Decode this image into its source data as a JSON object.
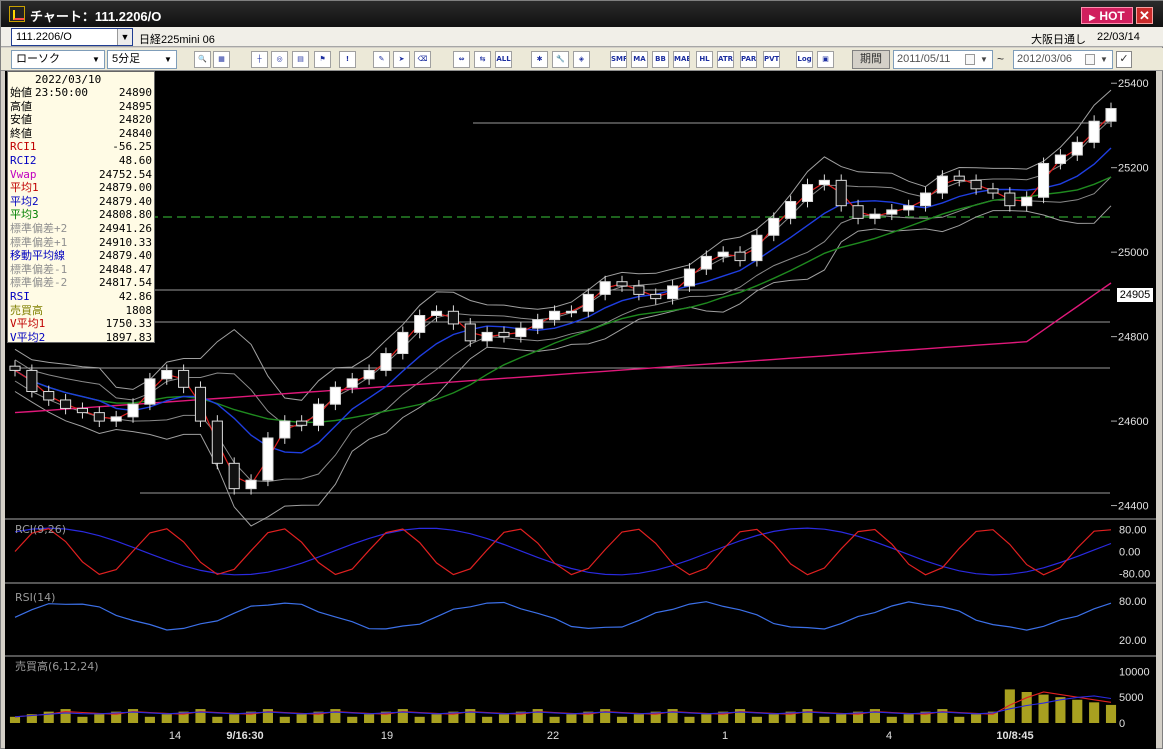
{
  "window": {
    "title": "チャート：111.2206/O",
    "hot_label": "HOT",
    "close_label": "✕"
  },
  "header": {
    "symbol": "111.2206/O",
    "instrument": "日経225mini 06",
    "market": "大阪日通し",
    "date": "22/03/14"
  },
  "toolbar": {
    "chart_type": "ローソク",
    "interval": "5分足",
    "period_label": "期間",
    "date_from": "2011/05/11",
    "date_to": "2012/03/06",
    "tilde": "~",
    "tools": [
      {
        "name": "zoom-icon",
        "text": "🔍"
      },
      {
        "name": "layout-icon",
        "text": "▦"
      },
      {
        "name": "candle-icon",
        "text": "┼"
      },
      {
        "name": "magnify-icon",
        "text": "◎"
      },
      {
        "name": "table-icon",
        "text": "▤"
      },
      {
        "name": "flag-icon",
        "text": "⚑"
      },
      {
        "name": "alert-icon",
        "text": "!"
      },
      {
        "name": "pen-icon",
        "text": "✎"
      },
      {
        "name": "pointer-icon",
        "text": "➤"
      },
      {
        "name": "eraser-icon",
        "text": "⌫"
      },
      {
        "name": "compare-icon",
        "text": "⇔"
      },
      {
        "name": "compare2-icon",
        "text": "⇆"
      },
      {
        "name": "all-icon",
        "text": "ALL"
      },
      {
        "name": "settings-icon",
        "text": "✱"
      },
      {
        "name": "wrench-icon",
        "text": "🔧"
      },
      {
        "name": "palette-icon",
        "text": "◈"
      },
      {
        "name": "smp-icon",
        "text": "SMP"
      },
      {
        "name": "ma-icon",
        "text": "MA"
      },
      {
        "name": "bb-icon",
        "text": "BB"
      },
      {
        "name": "mae-icon",
        "text": "MAE"
      },
      {
        "name": "hl-icon",
        "text": "HL"
      },
      {
        "name": "atr-icon",
        "text": "ATR"
      },
      {
        "name": "para-icon",
        "text": "PARA"
      },
      {
        "name": "pvt-icon",
        "text": "PVT"
      },
      {
        "name": "log-icon",
        "text": "Log"
      },
      {
        "name": "grid-icon",
        "text": "▣"
      }
    ]
  },
  "info": {
    "datetime": "2022/03/10 23:50:00",
    "rows": [
      {
        "label": "始値",
        "value": "24890",
        "color": "#000000"
      },
      {
        "label": "高値",
        "value": "24895",
        "color": "#000000"
      },
      {
        "label": "安値",
        "value": "24820",
        "color": "#000000"
      },
      {
        "label": "終値",
        "value": "24840",
        "color": "#000000"
      },
      {
        "label": "RCI1",
        "value": "-56.25",
        "color": "#c00000"
      },
      {
        "label": "RCI2",
        "value": "48.60",
        "color": "#0000c0"
      },
      {
        "label": "Vwap",
        "value": "24752.54",
        "color": "#c000c0"
      },
      {
        "label": "平均1",
        "value": "24879.00",
        "color": "#c00000"
      },
      {
        "label": "平均2",
        "value": "24879.40",
        "color": "#0000c0"
      },
      {
        "label": "平均3",
        "value": "24808.80",
        "color": "#008000"
      },
      {
        "label": "標準偏差+2",
        "value": "24941.26",
        "color": "#909090"
      },
      {
        "label": "標準偏差+1",
        "value": "24910.33",
        "color": "#909090"
      },
      {
        "label": "移動平均線",
        "value": "24879.40",
        "color": "#0000c0"
      },
      {
        "label": "標準偏差-1",
        "value": "24848.47",
        "color": "#909090"
      },
      {
        "label": "標準偏差-2",
        "value": "24817.54",
        "color": "#909090"
      },
      {
        "label": "RSI",
        "value": "42.86",
        "color": "#0000c0"
      },
      {
        "label": "売買高",
        "value": "1808",
        "color": "#808000"
      },
      {
        "label": "V平均1",
        "value": "1750.33",
        "color": "#c00000"
      },
      {
        "label": "V平均2",
        "value": "1897.83",
        "color": "#0000c0"
      }
    ]
  },
  "chart_data": {
    "type": "candlestick",
    "price_axis_ticks": [
      "25400",
      "25200",
      "25000",
      "24800",
      "24600",
      "24400"
    ],
    "ylim": [
      24380,
      25410
    ],
    "current_price": "24905",
    "x_labels": [
      "14",
      "9/16:30",
      "19",
      "22",
      "1",
      "4",
      "10/8:45"
    ],
    "close_series": [
      24720,
      24670,
      24650,
      24630,
      24620,
      24600,
      24610,
      24640,
      24700,
      24720,
      24680,
      24600,
      24500,
      24440,
      24460,
      24560,
      24600,
      24590,
      24640,
      24680,
      24700,
      24720,
      24760,
      24810,
      24850,
      24860,
      24830,
      24790,
      24810,
      24800,
      24820,
      24840,
      24860,
      24860,
      24900,
      24930,
      24920,
      24900,
      24890,
      24920,
      24960,
      24990,
      25000,
      24980,
      25040,
      25080,
      25120,
      25160,
      25170,
      25110,
      25080,
      25090,
      25100,
      25110,
      25140,
      25180,
      25170,
      25150,
      25140,
      25110,
      25130,
      25210,
      25230,
      25260,
      25310,
      25340
    ],
    "ma1": "red moving average (平均1)",
    "ma2": "blue moving average (平均2)",
    "ma3": "green moving average (平均3)",
    "vwap": "magenta (Vwap)",
    "subpanels": [
      {
        "label": "RCI(9,26)",
        "ticks": [
          "80.00",
          "0.00",
          "-80.00"
        ]
      },
      {
        "label": "RSI(14)",
        "ticks": [
          "80.00",
          "20.00"
        ]
      },
      {
        "label": "売買高(6,12,24)",
        "ticks": [
          "10000",
          "5000",
          "0"
        ]
      }
    ]
  }
}
